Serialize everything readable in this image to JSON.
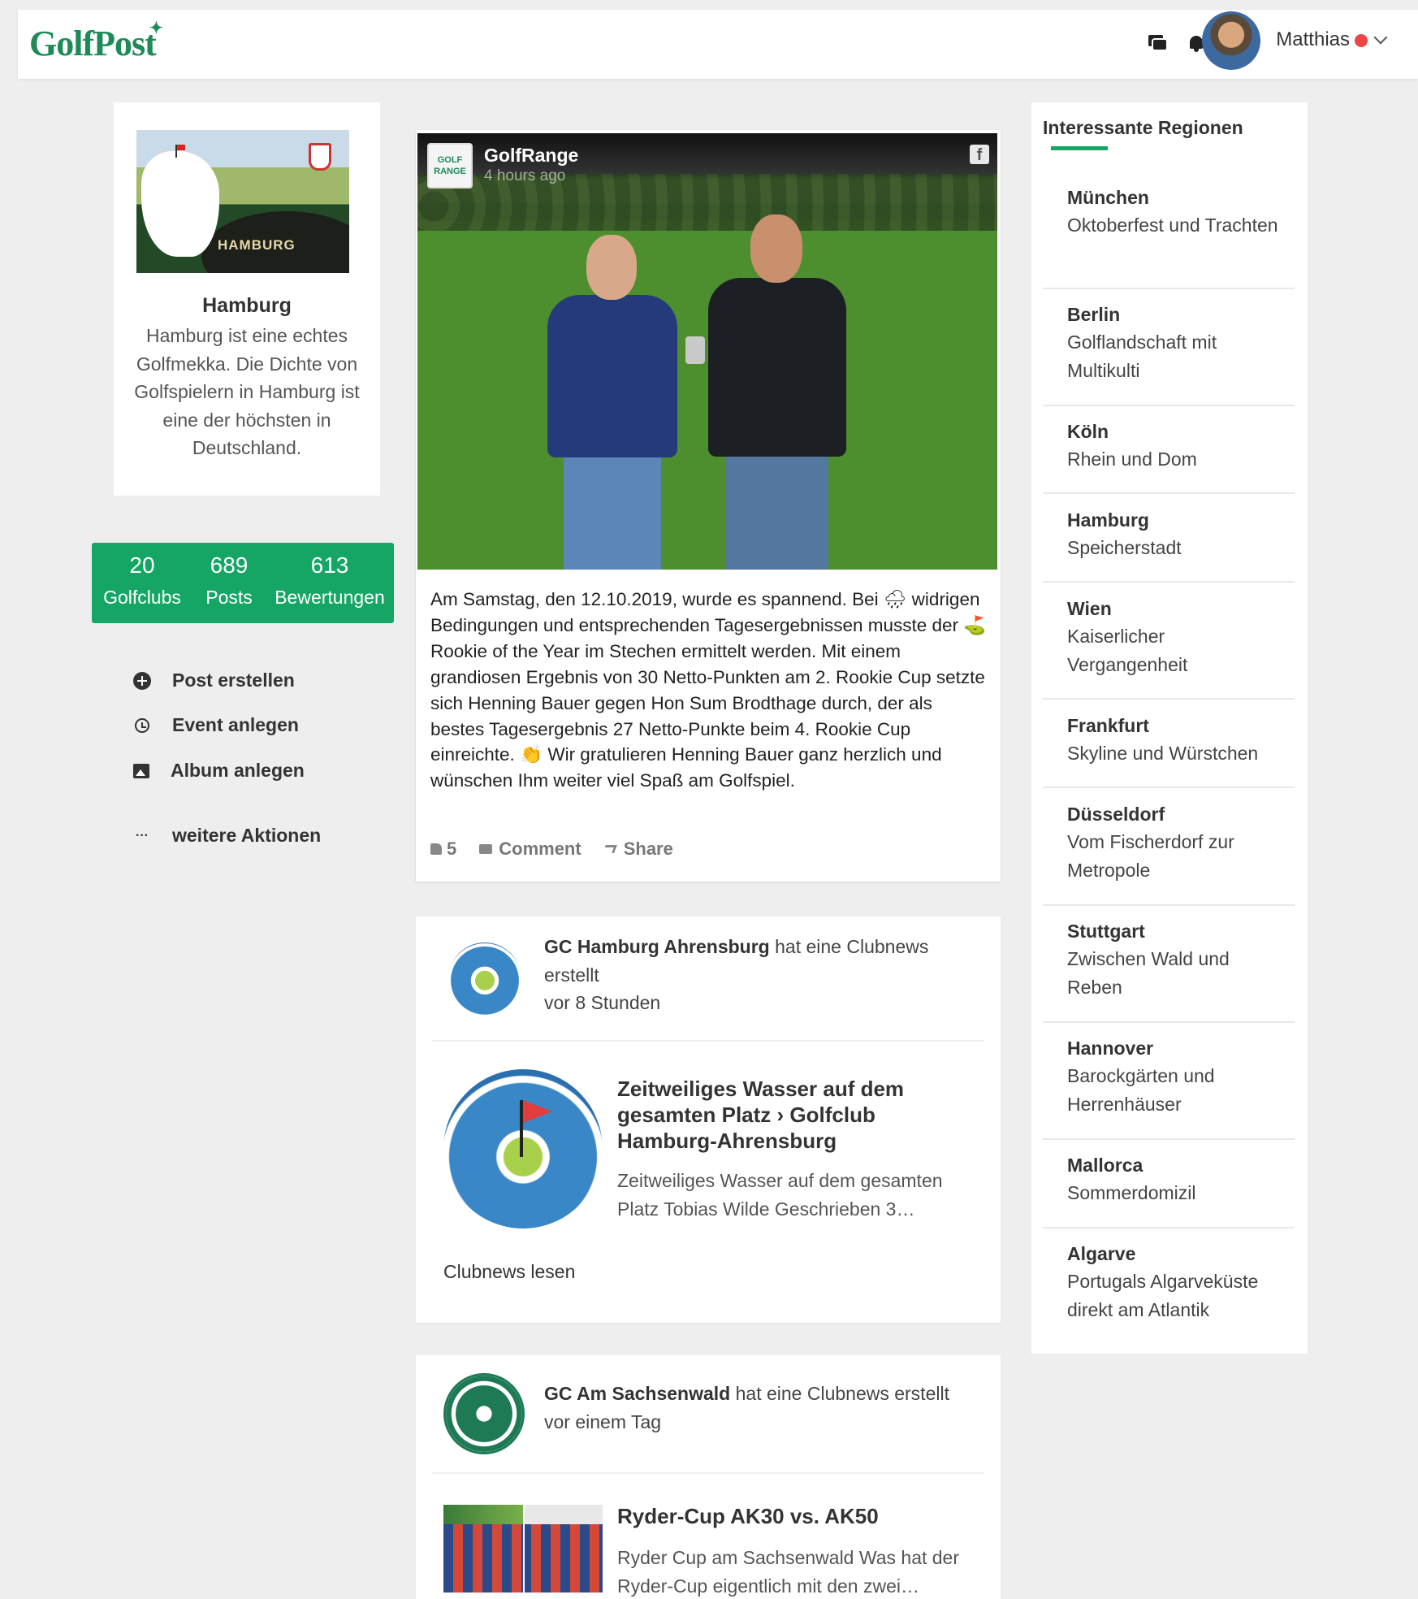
{
  "header": {
    "logo": "GolfPost",
    "username": "Matthias"
  },
  "region": {
    "image_label": "HAMBURG",
    "name": "Hamburg",
    "description": "Hamburg ist eine echtes Golfmekka. Die Dichte von Golfspielern in Hamburg ist eine der höchsten in Deutschland."
  },
  "stats": [
    {
      "value": "20",
      "label": "Golfclubs"
    },
    {
      "value": "689",
      "label": "Posts"
    },
    {
      "value": "613",
      "label": "Bewertungen"
    }
  ],
  "actions": [
    {
      "label": "Post erstellen",
      "icon": "plus-circle-icon"
    },
    {
      "label": "Event anlegen",
      "icon": "alarm-clock-icon"
    },
    {
      "label": "Album anlegen",
      "icon": "album-icon"
    },
    {
      "label": "weitere Aktionen",
      "icon": "more-dots-icon"
    }
  ],
  "post": {
    "author": "GolfRange",
    "logo_text": "GOLF RANGE",
    "time": "4 hours ago",
    "text": "Am Samstag, den 12.10.2019, wurde es spannend. Bei 🌧 widrigen Bedingungen und entsprechenden Tagesergebnissen musste der ⛳ Rookie of the Year im Stechen ermittelt werden. Mit einem grandiosen Ergebnis von 30 Netto-Punkten am 2. Rookie Cup setzte sich Henning Bauer gegen Hon Sum Brodthage durch, der als bestes Tagesergebnis 27 Netto-Punkte beim 4. Rookie Cup einreichte. 👏 Wir gratulieren Henning Bauer ganz herzlich und wünschen Ihm weiter viel Spaß am Golfspiel.",
    "likes": "5",
    "comment_label": "Comment",
    "share_label": "Share"
  },
  "news": [
    {
      "club": "GC Hamburg Ahrensburg",
      "action": "hat eine Clubnews erstellt",
      "time": "vor 8 Stunden",
      "title": "Zeitweiliges Wasser auf dem gesamten Platz › Golfclub Hamburg-Ahrensburg",
      "excerpt": "Zeitweiliges Wasser auf dem gesamten Platz Tobias Wilde Geschrieben 3…",
      "read_label": "Clubnews lesen"
    },
    {
      "club": "GC Am Sachsenwald",
      "action": "hat eine Clubnews erstellt",
      "time": "vor einem Tag",
      "title": "Ryder-Cup AK30 vs. AK50",
      "excerpt": "Ryder Cup am Sachsenwald  Was hat der Ryder-Cup eigentlich mit den zwei…"
    }
  ],
  "regions_panel": {
    "title": "Interessante Regionen",
    "accent": "#15a666",
    "items": [
      {
        "name": "München",
        "desc": "Oktoberfest und Trachten"
      },
      {
        "name": "Berlin",
        "desc": "Golflandschaft mit Multikulti"
      },
      {
        "name": "Köln",
        "desc": "Rhein und Dom"
      },
      {
        "name": "Hamburg",
        "desc": "Speicherstadt"
      },
      {
        "name": "Wien",
        "desc": "Kaiserlicher Vergangenheit"
      },
      {
        "name": "Frankfurt",
        "desc": "Skyline und Würstchen"
      },
      {
        "name": "Düsseldorf",
        "desc": "Vom Fischerdorf zur Metropole"
      },
      {
        "name": "Stuttgart",
        "desc": "Zwischen Wald und Reben"
      },
      {
        "name": "Hannover",
        "desc": "Barockgärten und Herrenhäuser"
      },
      {
        "name": "Mallorca",
        "desc": "Sommerdomizil"
      },
      {
        "name": "Algarve",
        "desc": "Portugals Algarveküste direkt am Atlantik"
      }
    ]
  }
}
